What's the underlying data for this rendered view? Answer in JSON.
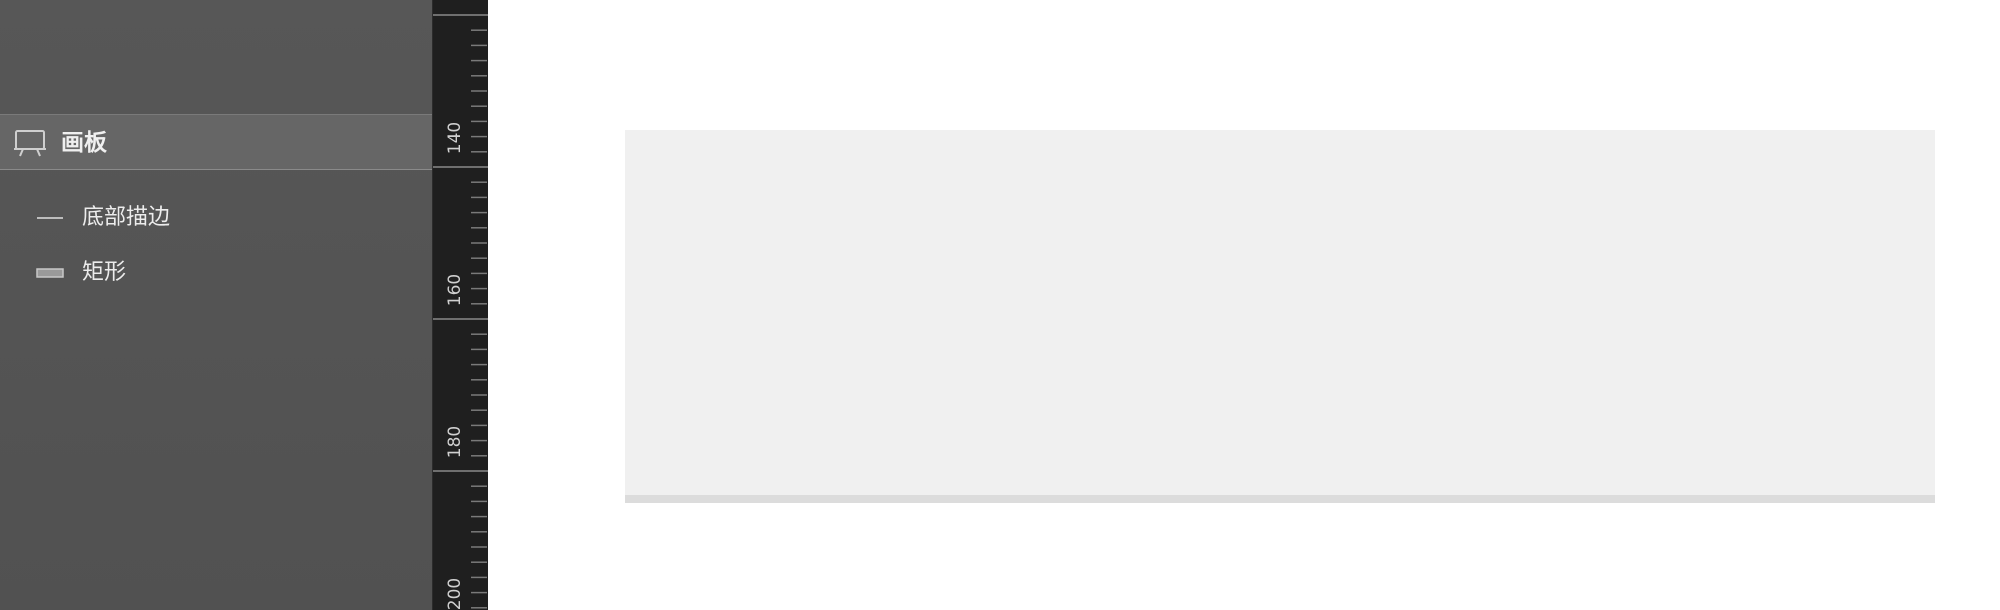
{
  "layers": {
    "artboard": {
      "label": "画板",
      "icon": "artboard-icon"
    },
    "items": [
      {
        "label": "底部描边",
        "icon": "line-icon"
      },
      {
        "label": "矩形",
        "icon": "rectangle-icon"
      }
    ]
  },
  "ruler": {
    "labels": [
      "140",
      "160",
      "180",
      "200"
    ]
  },
  "colors": {
    "panel_bg": "#545454",
    "selected_row_bg": "#666666",
    "ruler_bg": "#1f1f1f",
    "artboard_fill": "#f0f0f0",
    "bottom_stroke": "#dcdcdc"
  }
}
